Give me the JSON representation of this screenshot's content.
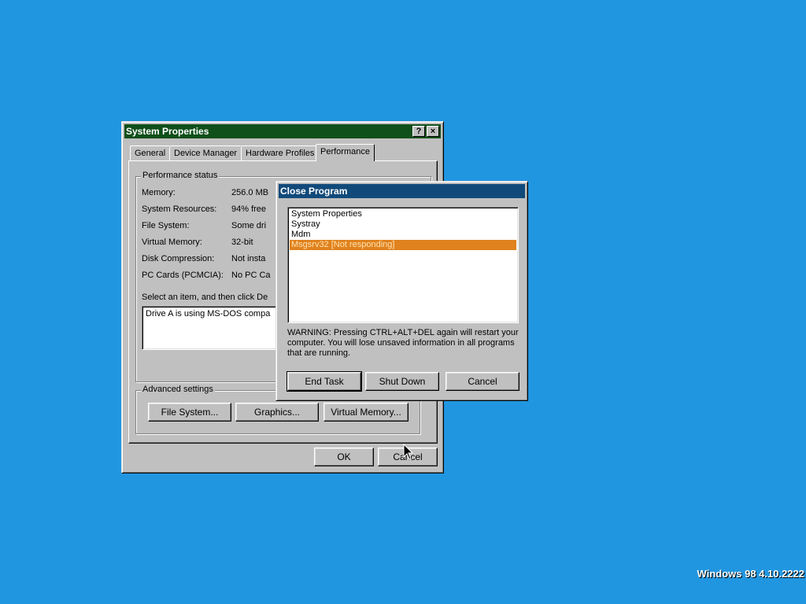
{
  "system_properties": {
    "title": "System Properties",
    "help_btn": "?",
    "close_btn": "×",
    "tabs": [
      {
        "label": "General"
      },
      {
        "label": "Device Manager"
      },
      {
        "label": "Hardware Profiles"
      },
      {
        "label": "Performance"
      }
    ],
    "perf_status_label": "Performance status",
    "rows": [
      {
        "label": "Memory:",
        "value": "256.0 MB"
      },
      {
        "label": "System Resources:",
        "value": "94% free"
      },
      {
        "label": "File System:",
        "value": "Some dri"
      },
      {
        "label": "Virtual Memory:",
        "value": "32-bit"
      },
      {
        "label": "Disk Compression:",
        "value": "Not insta"
      },
      {
        "label": "PC Cards (PCMCIA):",
        "value": "No PC Ca"
      }
    ],
    "select_prompt": "Select an item, and then click De",
    "details_text": "Drive A is using MS-DOS compa",
    "advanced_label": "Advanced settings",
    "buttons": {
      "file_system": "File System...",
      "graphics": "Graphics...",
      "virtual_memory": "Virtual Memory...",
      "ok": "OK",
      "cancel": "Cancel"
    }
  },
  "close_program": {
    "title": "Close Program",
    "tasks": [
      {
        "label": "System Properties",
        "selected": false
      },
      {
        "label": "Systray",
        "selected": false
      },
      {
        "label": "Mdm",
        "selected": false
      },
      {
        "label": "Msgsrv32 [Not responding]",
        "selected": true
      }
    ],
    "warning": "WARNING: Pressing CTRL+ALT+DEL again will restart your computer. You will lose unsaved information in all programs that are running.",
    "buttons": {
      "end_task": "End Task",
      "shut_down": "Shut Down",
      "cancel": "Cancel"
    }
  },
  "desktop": {
    "version": "Windows 98 4.10.2222"
  },
  "colors": {
    "desktop": "#2196e0",
    "inactive_title": "#0f4f1a",
    "active_title": "#114a7a",
    "selection": "#e0821e"
  }
}
